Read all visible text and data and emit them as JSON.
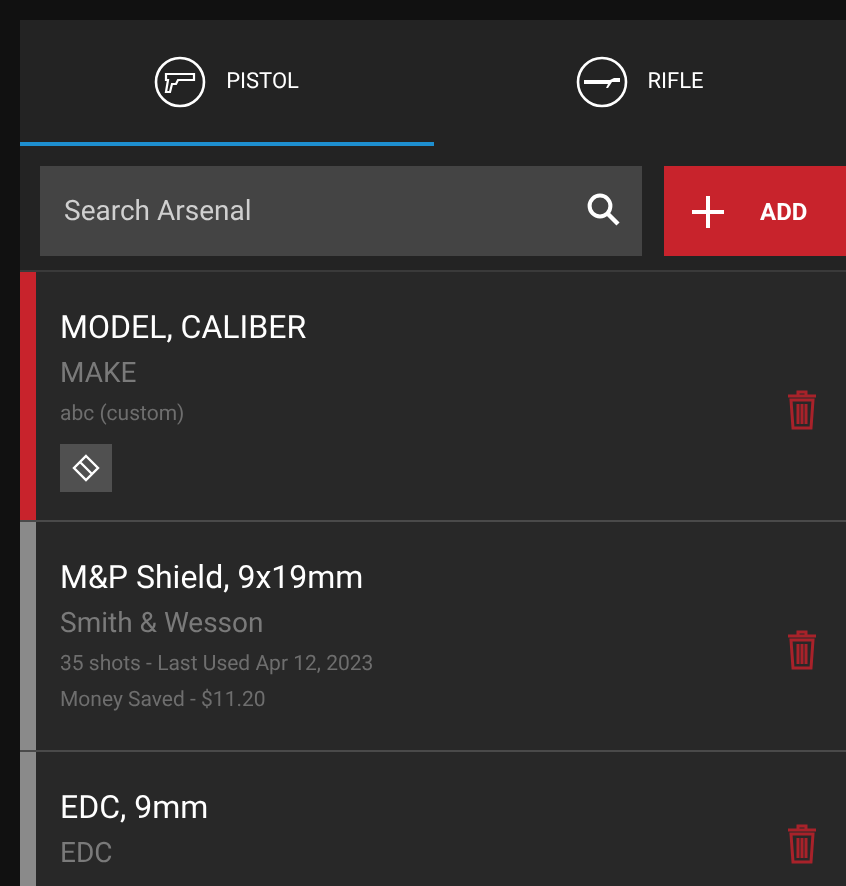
{
  "tabs": [
    {
      "label": "PISTOL",
      "kind": "pistol",
      "selected": true
    },
    {
      "label": "RIFLE",
      "kind": "rifle",
      "selected": false
    }
  ],
  "search": {
    "placeholder": "Search Arsenal"
  },
  "add_button": {
    "label": "ADD"
  },
  "firearms": [
    {
      "title": "MODEL, CALIBER",
      "make": "MAKE",
      "details": [
        "abc (custom)"
      ],
      "color": "#c8232c",
      "tagged": true
    },
    {
      "title": "M&P Shield, 9x19mm",
      "make": "Smith & Wesson",
      "details": [
        "35 shots - Last Used Apr 12, 2023",
        "Money Saved - $11.20"
      ],
      "color": "#8a8a8a",
      "tagged": false
    },
    {
      "title": "EDC, 9mm",
      "make": "EDC",
      "color": "#8a8a8a",
      "tagged": false
    }
  ]
}
